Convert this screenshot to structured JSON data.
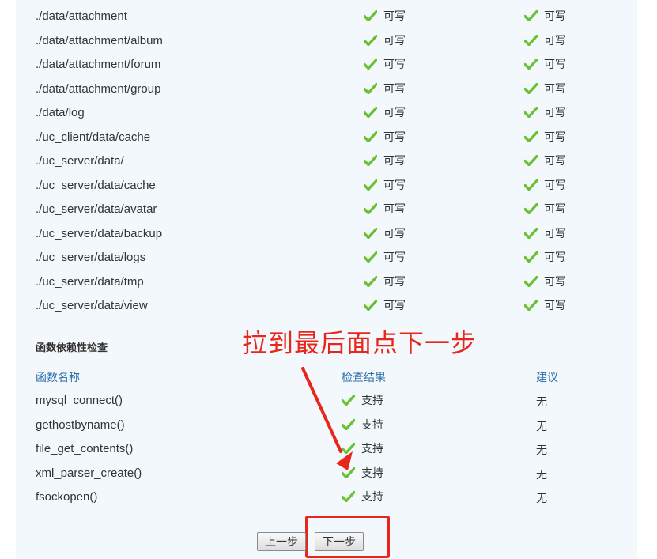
{
  "directories": [
    {
      "path": "./data/attachment",
      "current": "可写",
      "required": "可写"
    },
    {
      "path": "./data/attachment/album",
      "current": "可写",
      "required": "可写"
    },
    {
      "path": "./data/attachment/forum",
      "current": "可写",
      "required": "可写"
    },
    {
      "path": "./data/attachment/group",
      "current": "可写",
      "required": "可写"
    },
    {
      "path": "./data/log",
      "current": "可写",
      "required": "可写"
    },
    {
      "path": "./uc_client/data/cache",
      "current": "可写",
      "required": "可写"
    },
    {
      "path": "./uc_server/data/",
      "current": "可写",
      "required": "可写"
    },
    {
      "path": "./uc_server/data/cache",
      "current": "可写",
      "required": "可写"
    },
    {
      "path": "./uc_server/data/avatar",
      "current": "可写",
      "required": "可写"
    },
    {
      "path": "./uc_server/data/backup",
      "current": "可写",
      "required": "可写"
    },
    {
      "path": "./uc_server/data/logs",
      "current": "可写",
      "required": "可写"
    },
    {
      "path": "./uc_server/data/tmp",
      "current": "可写",
      "required": "可写"
    },
    {
      "path": "./uc_server/data/view",
      "current": "可写",
      "required": "可写"
    }
  ],
  "functions_section": {
    "title": "函数依赖性检查",
    "headers": {
      "name": "函数名称",
      "result": "检查结果",
      "suggestion": "建议"
    },
    "rows": [
      {
        "name": "mysql_connect()",
        "result": "支持",
        "suggestion": "无"
      },
      {
        "name": "gethostbyname()",
        "result": "支持",
        "suggestion": "无"
      },
      {
        "name": "file_get_contents()",
        "result": "支持",
        "suggestion": "无"
      },
      {
        "name": "xml_parser_create()",
        "result": "支持",
        "suggestion": "无"
      },
      {
        "name": "fsockopen()",
        "result": "支持",
        "suggestion": "无"
      }
    ]
  },
  "annotation": "拉到最后面点下一步",
  "buttons": {
    "prev": "上一步",
    "next": "下一步"
  },
  "colors": {
    "check": "#6cc132",
    "header": "#2e6fa8",
    "annotation": "#e8261b"
  },
  "icons": {
    "status": "check-icon"
  }
}
